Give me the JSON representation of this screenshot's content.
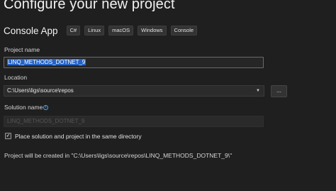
{
  "header": {
    "title": "Configure your new project"
  },
  "template": {
    "name": "Console App",
    "tags": [
      "C#",
      "Linux",
      "macOS",
      "Windows",
      "Console"
    ]
  },
  "project_name": {
    "label": "Project name",
    "value": "LINQ_METHODS_DOTNET_9"
  },
  "location": {
    "label": "Location",
    "value": "C:\\Users\\ligs\\source\\repos",
    "browse_label": "..."
  },
  "solution_name": {
    "label": "Solution name",
    "value": "LINQ_METHODS_DOTNET_9"
  },
  "same_directory": {
    "label": "Place solution and project in the same directory",
    "checked": true,
    "check_glyph": "✓"
  },
  "footer": {
    "path_note": "Project will be created in \"C:\\Users\\ligs\\source\\repos\\LINQ_METHODS_DOTNET_9\\\""
  },
  "icons": {
    "info_icon": "i",
    "dropdown_icon": "▼"
  },
  "colors": {
    "background": "#1f1f1f",
    "selection": "#2563c7",
    "info_accent": "#4da3ff"
  }
}
